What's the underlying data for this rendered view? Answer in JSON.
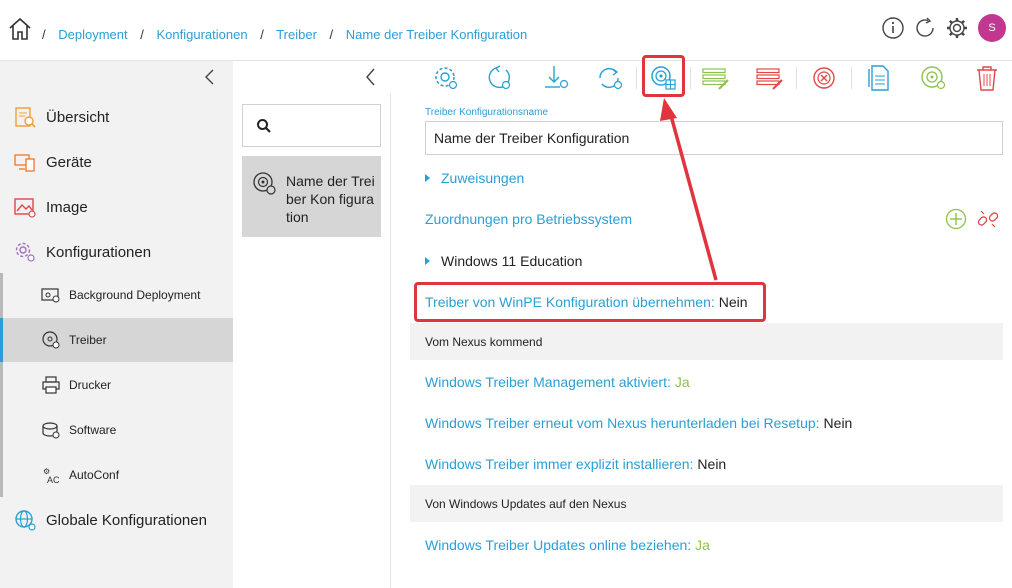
{
  "breadcrumb": {
    "items": [
      "Deployment",
      "Konfigurationen",
      "Treiber",
      "Name der Treiber Konfiguration"
    ],
    "separator": "/"
  },
  "header": {
    "avatar_initial": "S",
    "icons": [
      "info-icon",
      "refresh-icon",
      "gear-icon"
    ]
  },
  "sidebar": {
    "items": [
      {
        "label": "Übersicht",
        "icon": "overview-icon"
      },
      {
        "label": "Geräte",
        "icon": "devices-icon"
      },
      {
        "label": "Image",
        "icon": "image-icon"
      },
      {
        "label": "Konfigurationen",
        "icon": "configurations-icon"
      }
    ],
    "sub_items": [
      {
        "label": "Background Deployment",
        "icon": "background-deployment-icon"
      },
      {
        "label": "Treiber",
        "icon": "driver-icon"
      },
      {
        "label": "Drucker",
        "icon": "printer-icon"
      },
      {
        "label": "Software",
        "icon": "software-icon"
      },
      {
        "label": "AutoConf",
        "icon": "autoconf-icon"
      }
    ],
    "global": {
      "label": "Globale Konfigurationen",
      "icon": "globe-gear-icon"
    },
    "active_sub": "Treiber"
  },
  "list": {
    "search_placeholder": "",
    "items": [
      {
        "label": "Name der Treiber Kon figuration"
      }
    ]
  },
  "detail": {
    "name_label": "Treiber Konfigurationsname",
    "name_value": "Name der Treiber Konfiguration",
    "assignments": "Zuweisungen",
    "os_mapping": "Zuordnungen pro Betriebssystem",
    "os_entry": "Windows 11 Education",
    "winpe_label": "Treiber von WinPE Konfiguration übernehmen:",
    "winpe_value": "Nein",
    "section_nexus": "Vom Nexus kommend",
    "mgmt_label": "Windows Treiber Management aktiviert:",
    "mgmt_value": "Ja",
    "redownload_label": "Windows Treiber erneut vom Nexus herunterladen bei Resetup:",
    "redownload_value": "Nein",
    "explicit_label": "Windows Treiber immer explizit installieren:",
    "explicit_value": "Nein",
    "section_updates": "Von Windows Updates auf den Nexus",
    "online_label": "Windows Treiber Updates online beziehen:",
    "online_value": "Ja"
  },
  "colors": {
    "accent": "#2a9fd6",
    "green": "#8bc34a",
    "red": "#e0343f",
    "highlight": "#e0343f",
    "avatar": "#c2378f"
  }
}
